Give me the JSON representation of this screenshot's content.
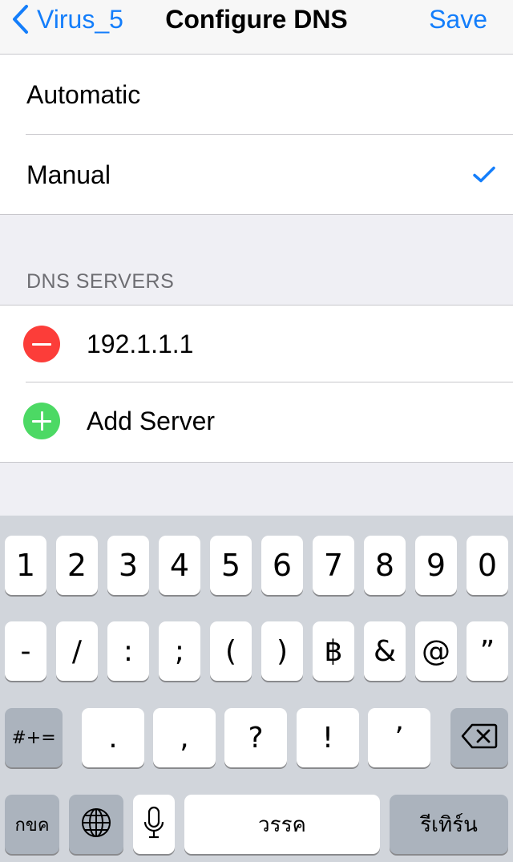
{
  "nav": {
    "back_label": "Virus_5",
    "title": "Configure DNS",
    "save_label": "Save"
  },
  "mode": {
    "options": [
      "Automatic",
      "Manual"
    ],
    "selected": "Manual"
  },
  "servers": {
    "header": "DNS SERVERS",
    "entries": [
      "192.1.1.1"
    ],
    "add_label": "Add Server"
  },
  "keyboard": {
    "row1": [
      "1",
      "2",
      "3",
      "4",
      "5",
      "6",
      "7",
      "8",
      "9",
      "0"
    ],
    "row2": [
      "-",
      "/",
      ":",
      ";",
      "(",
      ")",
      "฿",
      "&",
      "@",
      "”"
    ],
    "row3": {
      "shift_label": "#+=",
      "keys": [
        ".",
        ",",
        "?",
        "!",
        "’"
      ]
    },
    "row4": {
      "lang_label": "กขค",
      "space_label": "วรรค",
      "return_label": "รีเทิร์น"
    }
  },
  "icons": {
    "back": "chevron-left-icon",
    "check": "checkmark-icon",
    "remove": "minus-circle-icon",
    "add": "plus-circle-icon",
    "delete": "backspace-icon",
    "globe": "globe-icon",
    "mic": "microphone-icon"
  },
  "colors": {
    "tint": "#147efb",
    "remove": "#fc3d39",
    "add": "#4cd964",
    "grouped_background": "#efeff4",
    "keyboard_background": "#d1d5db"
  }
}
